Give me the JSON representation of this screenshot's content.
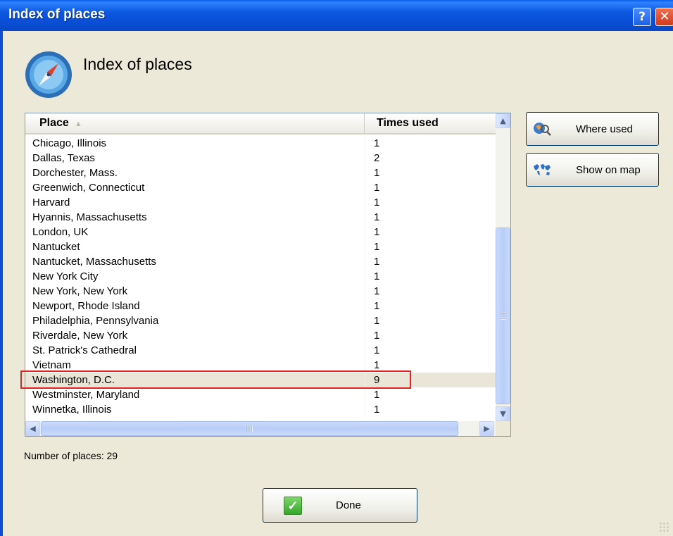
{
  "window": {
    "title": "Index of places",
    "help_label": "?",
    "close_label": "✕"
  },
  "header": {
    "heading": "Index of places",
    "icon": "compass-icon"
  },
  "table": {
    "columns": [
      "Place",
      "Times used"
    ],
    "sort_indicator": "▲",
    "rows": [
      {
        "place": "Chicago, Illinois",
        "count": "1"
      },
      {
        "place": "Dallas, Texas",
        "count": "2"
      },
      {
        "place": "Dorchester, Mass.",
        "count": "1"
      },
      {
        "place": "Greenwich, Connecticut",
        "count": "1"
      },
      {
        "place": "Harvard",
        "count": "1"
      },
      {
        "place": "Hyannis, Massachusetts",
        "count": "1"
      },
      {
        "place": "London, UK",
        "count": "1"
      },
      {
        "place": "Nantucket",
        "count": "1"
      },
      {
        "place": "Nantucket, Massachusetts",
        "count": "1"
      },
      {
        "place": "New York City",
        "count": "1"
      },
      {
        "place": "New York, New York",
        "count": "1"
      },
      {
        "place": "Newport, Rhode Island",
        "count": "1"
      },
      {
        "place": "Philadelphia, Pennsylvania",
        "count": "1"
      },
      {
        "place": "Riverdale, New York",
        "count": "1"
      },
      {
        "place": "St. Patrick's Cathedral",
        "count": "1"
      },
      {
        "place": "Vietnam",
        "count": "1"
      },
      {
        "place": "Washington, D.C.",
        "count": "9"
      },
      {
        "place": "Westminster, Maryland",
        "count": "1"
      },
      {
        "place": "Winnetka, Illinois",
        "count": "1"
      }
    ],
    "selected_row": "Washington, D.C."
  },
  "actions": {
    "where_used": "Where used",
    "show_on_map": "Show on map",
    "where_used_icon": "search-map-icon",
    "show_on_map_icon": "world-map-icon"
  },
  "footer": {
    "count_text": "Number of places: 29",
    "done": "Done",
    "done_icon": "checkmark-icon"
  },
  "colors": {
    "titlebar": "#0a4fd6",
    "highlight": "#e32222",
    "dialog_bg": "#ece9d8"
  }
}
